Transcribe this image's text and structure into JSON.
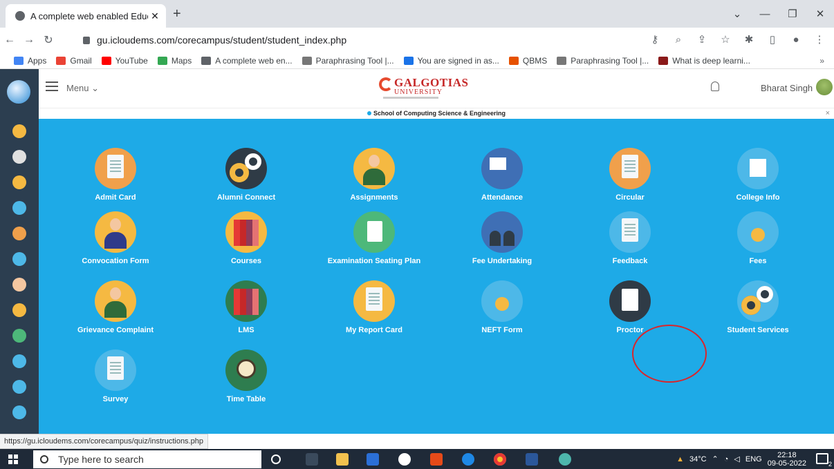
{
  "browser": {
    "tab_title": "A complete web enabled Educati",
    "tab_close": "✕",
    "new_tab": "+",
    "url": "gu.icloudems.com/corecampus/student/student_index.php",
    "bookmarks": [
      {
        "label": "Apps",
        "color": "#4285f4"
      },
      {
        "label": "Gmail",
        "color": "#ea4335"
      },
      {
        "label": "YouTube",
        "color": "#ff0000"
      },
      {
        "label": "Maps",
        "color": "#34a853"
      },
      {
        "label": "A complete web en...",
        "color": "#5f6368"
      },
      {
        "label": "Paraphrasing Tool |...",
        "color": "#777777"
      },
      {
        "label": "You are signed in as...",
        "color": "#1a73e8"
      },
      {
        "label": "QBMS",
        "color": "#e65100"
      },
      {
        "label": "Paraphrasing Tool |...",
        "color": "#777777"
      },
      {
        "label": "What is deep learni...",
        "color": "#8b1a1a"
      }
    ],
    "bookmarks_more": "»"
  },
  "header": {
    "menu_label": "Menu ⌄",
    "logo_name": "GALGOTIAS",
    "logo_sub": "UNIVERSITY",
    "user_name": "Bharat Singh"
  },
  "school_bar": {
    "text": "School of Computing Science & Engineering",
    "close": "×"
  },
  "tiles": [
    {
      "label": "Admit Card",
      "icon": "admit-card-icon",
      "color": "#f0a04b"
    },
    {
      "label": "Alumni Connect",
      "icon": "gears-icon",
      "color": "#2f3b46"
    },
    {
      "label": "Assignments",
      "icon": "person-icon",
      "color": "#f5b942"
    },
    {
      "label": "Attendance",
      "icon": "presentation-icon",
      "color": "#3f6fb5"
    },
    {
      "label": "Circular",
      "icon": "document-icon",
      "color": "#f0a04b"
    },
    {
      "label": "College Info",
      "icon": "building-icon",
      "color": "#4db8e8"
    },
    {
      "label": "Convocation Form",
      "icon": "graduate-icon",
      "color": "#f5b942"
    },
    {
      "label": "Courses",
      "icon": "books-icon",
      "color": "#f5b942"
    },
    {
      "label": "Examination Seating Plan",
      "icon": "exam-grade-icon",
      "color": "#4db87a"
    },
    {
      "label": "Fee Undertaking",
      "icon": "group-icon",
      "color": "#3f6fb5"
    },
    {
      "label": "Feedback",
      "icon": "feedback-form-icon",
      "color": "#4db8e8"
    },
    {
      "label": "Fees",
      "icon": "fees-icon",
      "color": "#4db8e8"
    },
    {
      "label": "Grievance Complaint",
      "icon": "person-icon",
      "color": "#f5b942"
    },
    {
      "label": "LMS",
      "icon": "books-icon",
      "color": "#2e7d4f"
    },
    {
      "label": "My Report Card",
      "icon": "report-icon",
      "color": "#f5b942"
    },
    {
      "label": "NEFT Form",
      "icon": "neft-icon",
      "color": "#4db8e8"
    },
    {
      "label": "Proctor",
      "icon": "proctor-icon",
      "color": "#2f3b46"
    },
    {
      "label": "Student Services",
      "icon": "gears-icon",
      "color": "#4db8e8"
    },
    {
      "label": "Survey",
      "icon": "survey-icon",
      "color": "#4db8e8"
    },
    {
      "label": "Time Table",
      "icon": "alarm-clock-icon",
      "color": "#2e7d4f"
    }
  ],
  "status_url": "https://gu.icloudems.com/corecampus/quiz/instructions.php",
  "taskbar": {
    "search_placeholder": "Type here to search",
    "temperature": "34°C",
    "language": "ENG",
    "time": "22:18",
    "date": "09-05-2022",
    "notification_count": "2"
  }
}
